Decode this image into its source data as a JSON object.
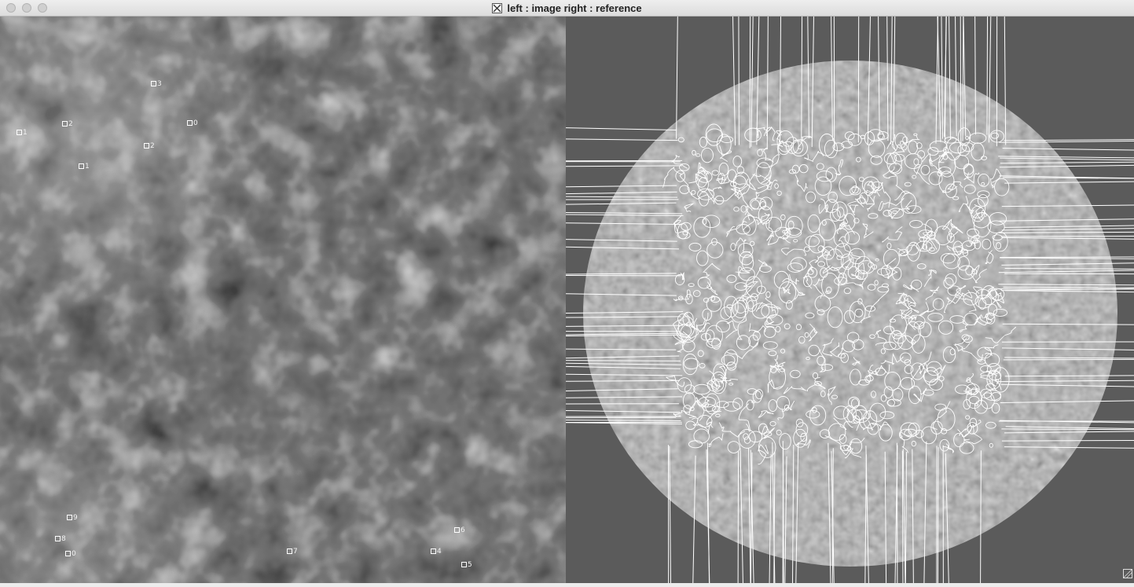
{
  "window": {
    "title": "left : image   right : reference",
    "app_icon": "x11-icon"
  },
  "left_panel": {
    "markers": [
      {
        "id": "marker-1",
        "label": "1"
      },
      {
        "id": "marker-2",
        "label": "2"
      },
      {
        "id": "marker-3",
        "label": "3"
      },
      {
        "id": "marker-0",
        "label": "0"
      },
      {
        "id": "marker-2b",
        "label": "2"
      },
      {
        "id": "marker-1b",
        "label": "1"
      },
      {
        "id": "marker-9",
        "label": "9"
      },
      {
        "id": "marker-8",
        "label": "8"
      },
      {
        "id": "marker-0b",
        "label": "0"
      },
      {
        "id": "marker-7",
        "label": "7"
      },
      {
        "id": "marker-4",
        "label": "4"
      },
      {
        "id": "marker-6",
        "label": "6"
      },
      {
        "id": "marker-5",
        "label": "5"
      }
    ]
  },
  "colors": {
    "title_bg": "#e4e4e4",
    "right_bg": "#5b5b5b",
    "contour": "#ffffff"
  }
}
